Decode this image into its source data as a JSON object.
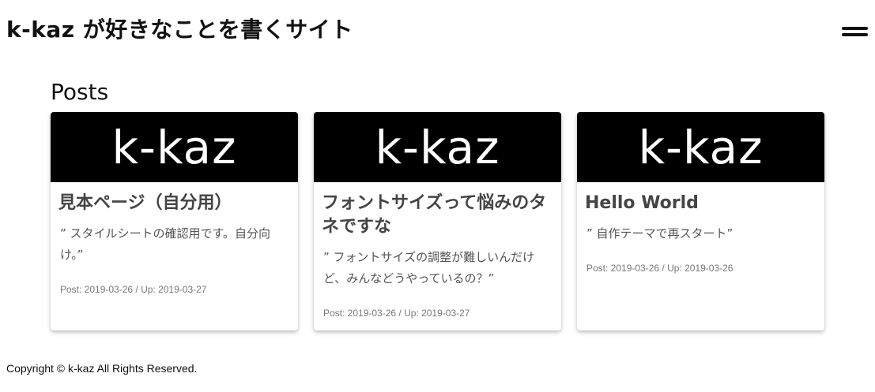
{
  "header": {
    "site_title": "k-kaz が好きなことを書くサイト",
    "menu_icon": "hamburger-menu-icon"
  },
  "main": {
    "heading": "Posts",
    "posts": [
      {
        "thumbnail_text": "k-kaz",
        "title": "見本ページ（自分用）",
        "excerpt": "” スタイルシートの確認用です。自分向け。”",
        "meta": "Post: 2019-03-26 / Up: 2019-03-27"
      },
      {
        "thumbnail_text": "k-kaz",
        "title": "フォントサイズって悩みのタネですな",
        "excerpt": "” フォントサイズの調整が難しいんだけど、みんなどうやっているの？”",
        "meta": "Post: 2019-03-26 / Up: 2019-03-27"
      },
      {
        "thumbnail_text": "k-kaz",
        "title": "Hello World",
        "excerpt": "” 自作テーマで再スタート”",
        "meta": "Post: 2019-03-26 / Up: 2019-03-26"
      }
    ]
  },
  "footer": {
    "copyright": "Copyright © k-kaz All Rights Reserved."
  },
  "colors": {
    "background": "#ffffff",
    "thumbnail_background": "#000000",
    "card_title": "#444444",
    "card_text": "#555555",
    "card_meta": "#777777"
  }
}
